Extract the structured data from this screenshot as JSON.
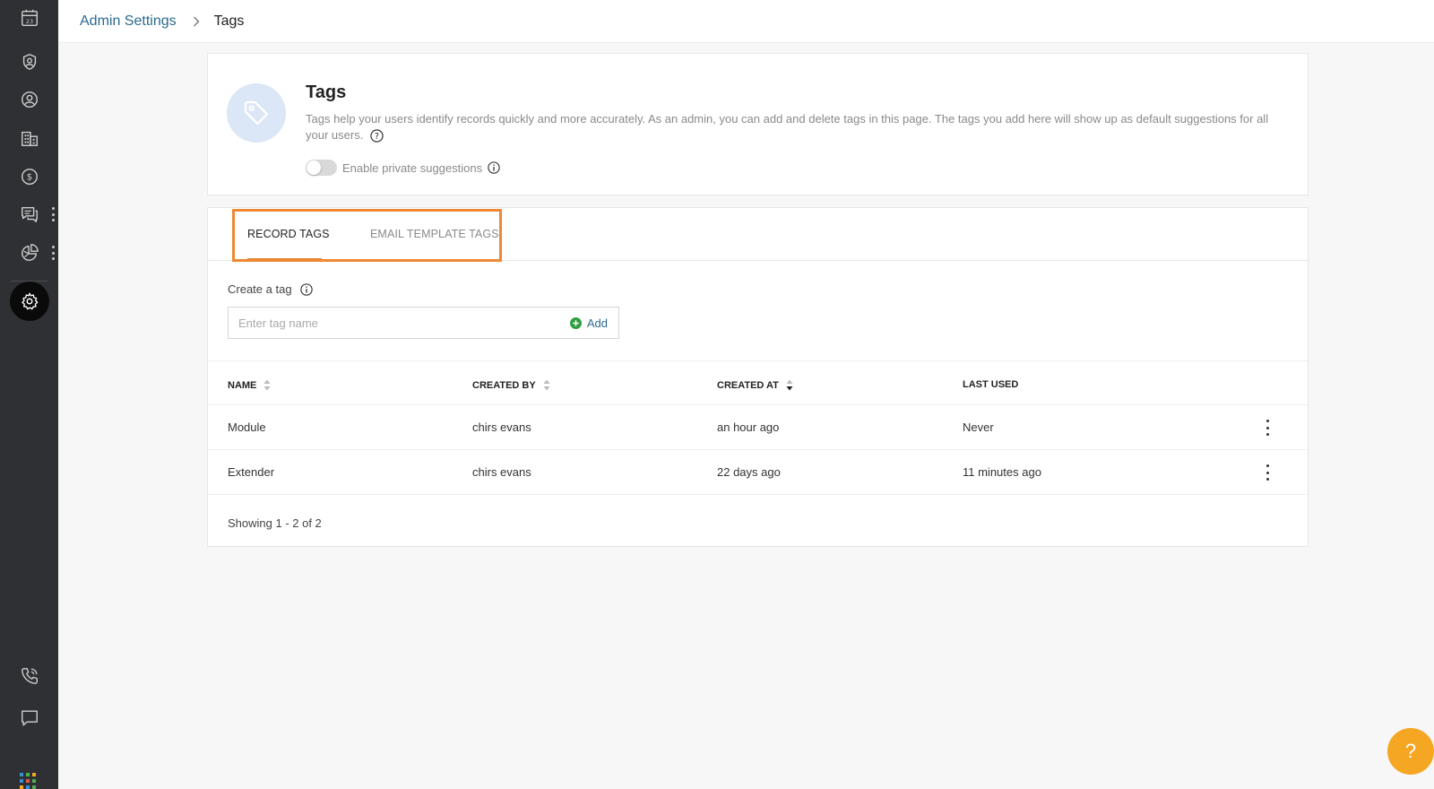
{
  "breadcrumb": {
    "parent": "Admin Settings",
    "current": "Tags"
  },
  "sidebar": {
    "items": [
      {
        "name": "calendar",
        "icon": "calendar-icon",
        "date": "23"
      },
      {
        "name": "contacts",
        "icon": "contact-icon"
      },
      {
        "name": "accounts",
        "icon": "user-icon"
      },
      {
        "name": "companies",
        "icon": "building-icon"
      },
      {
        "name": "deals",
        "icon": "dollar-icon"
      },
      {
        "name": "conversations",
        "icon": "chat-icon"
      },
      {
        "name": "reports",
        "icon": "pie-chart-icon"
      },
      {
        "name": "settings",
        "icon": "gear-icon",
        "active": true
      },
      {
        "name": "phone",
        "icon": "phone-icon"
      },
      {
        "name": "messages",
        "icon": "message-icon"
      },
      {
        "name": "apps",
        "icon": "apps-grid-icon"
      }
    ]
  },
  "intro": {
    "title": "Tags",
    "description": "Tags help your users identify records quickly and more accurately. As an admin, you can add and delete tags in this page. The tags you add here will show up as default suggestions for all your users.",
    "toggle_label": "Enable private suggestions",
    "toggle_on": false
  },
  "tabs": [
    {
      "label": "RECORD TAGS",
      "active": true
    },
    {
      "label": "EMAIL TEMPLATE TAGS",
      "active": false
    }
  ],
  "create": {
    "label": "Create a tag",
    "placeholder": "Enter tag name",
    "value": "",
    "add_label": "Add"
  },
  "table": {
    "columns": [
      "NAME",
      "CREATED BY",
      "CREATED AT",
      "LAST USED"
    ],
    "rows": [
      {
        "name": "Module",
        "created_by": "chirs evans",
        "created_at": "an hour ago",
        "last_used": "Never"
      },
      {
        "name": "Extender",
        "created_by": "chirs evans",
        "created_at": "22 days ago",
        "last_used": "11 minutes ago"
      }
    ],
    "footer": "Showing 1 - 2 of 2"
  },
  "help_button": {
    "label": "?"
  },
  "colors": {
    "sidebar_bg": "#2e3033",
    "link": "#2b6a8e",
    "highlight": "#ee8833",
    "add_icon": "#2e9e3e",
    "fab": "#f5a623"
  }
}
